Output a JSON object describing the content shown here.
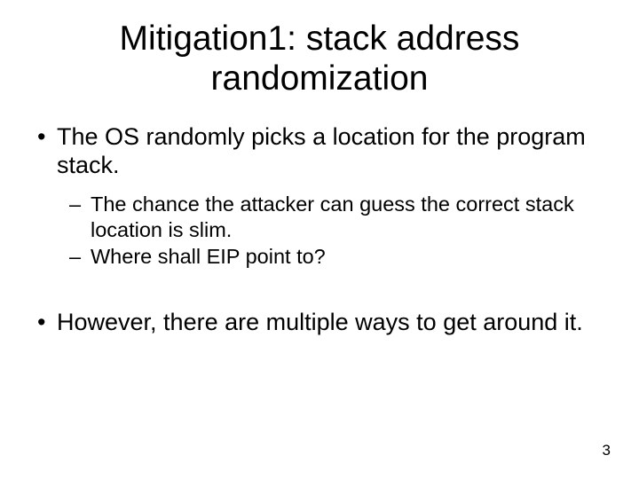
{
  "title": "Mitigation1: stack address randomization",
  "bullets": {
    "b1": "The OS randomly picks a location for the program stack.",
    "b1a": "The chance the attacker can guess the correct stack location is slim.",
    "b1b": "Where shall EIP point to?",
    "b2": "However, there are multiple ways to get around it."
  },
  "page_number": "3"
}
